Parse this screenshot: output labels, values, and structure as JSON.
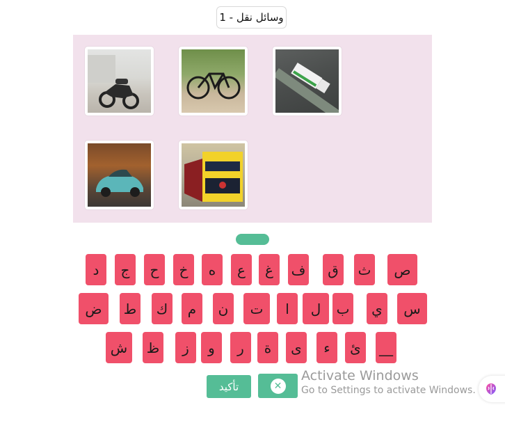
{
  "header": {
    "title": "وسائل نقل - 1"
  },
  "images": [
    {
      "label": "motorcycle",
      "icon": "motorcycle-photo"
    },
    {
      "label": "bicycle",
      "icon": "bicycle-photo"
    },
    {
      "label": "truck",
      "icon": "truck-photo"
    },
    {
      "label": "car",
      "icon": "car-photo"
    },
    {
      "label": "train",
      "icon": "train-photo"
    }
  ],
  "keyboard": {
    "row1": [
      "ص",
      "ث",
      "ق",
      "ف",
      "غ",
      "ع",
      "ه",
      "خ",
      "ح",
      "ج",
      "د"
    ],
    "row2": [
      "س",
      "ي",
      "ب",
      "ل",
      "ا",
      "ت",
      "ن",
      "م",
      "ك",
      "ط",
      "ض"
    ],
    "row3": [
      "__",
      "ئ",
      "ء",
      "ى",
      "ة",
      "ر",
      "و",
      "ز",
      "ظ",
      "ش"
    ]
  },
  "actions": {
    "confirm_label": "تأكيد",
    "clear_icon": "close-icon"
  },
  "watermark": {
    "line1": "Activate Windows",
    "line2": "Go to Settings to activate Windows."
  },
  "colors": {
    "key": "#f0506a",
    "accent": "#55bd96",
    "panel": "#f2e1ec"
  }
}
